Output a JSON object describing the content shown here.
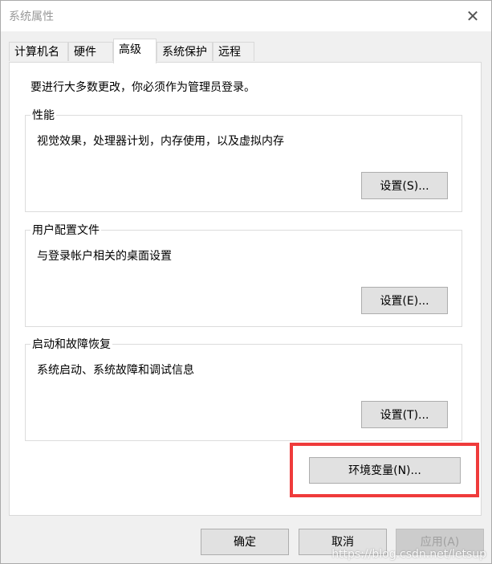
{
  "window": {
    "title": "系统属性"
  },
  "tabs": [
    {
      "label": "计算机名"
    },
    {
      "label": "硬件"
    },
    {
      "label": "高级"
    },
    {
      "label": "系统保护"
    },
    {
      "label": "远程"
    }
  ],
  "active_tab": "高级",
  "panel": {
    "admin_note": "要进行大多数更改，你必须作为管理员登录。",
    "performance": {
      "title": "性能",
      "description": "视觉效果，处理器计划，内存使用，以及虚拟内存",
      "button": "设置(S)..."
    },
    "user_profiles": {
      "title": "用户配置文件",
      "description": "与登录帐户相关的桌面设置",
      "button": "设置(E)..."
    },
    "startup_recovery": {
      "title": "启动和故障恢复",
      "description": "系统启动、系统故障和调试信息",
      "button": "设置(T)..."
    },
    "env_button": "环境变量(N)..."
  },
  "footer": {
    "ok": "确定",
    "cancel": "取消",
    "apply": "应用(A)"
  },
  "watermark": "https://blog.csdn.net/letsup",
  "colors": {
    "highlight": "#ef3b3b",
    "panel_bg": "#ffffff",
    "window_bg": "#f0f0f0"
  }
}
